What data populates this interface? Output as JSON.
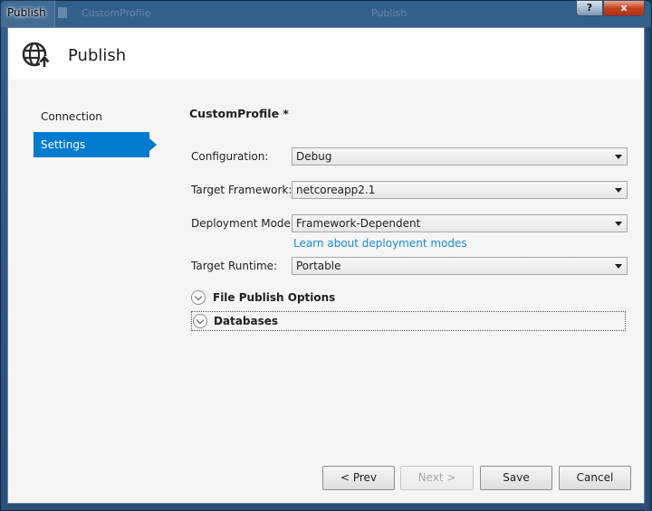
{
  "window": {
    "title": "Publish",
    "ghost_tab_1": "CustomProfile",
    "ghost_tab_2": "Publish",
    "help_label": "?",
    "close_label": "x"
  },
  "header": {
    "title": "Publish",
    "icon": "globe-publish-icon"
  },
  "nav": {
    "items": [
      {
        "label": "Connection",
        "active": false
      },
      {
        "label": "Settings",
        "active": true
      }
    ]
  },
  "profile": {
    "name": "CustomProfile *"
  },
  "form": {
    "configuration": {
      "label": "Configuration:",
      "value": "Debug"
    },
    "target_framework": {
      "label": "Target Framework:",
      "value": "netcoreapp2.1"
    },
    "deployment_mode": {
      "label": "Deployment Mode:",
      "value": "Framework-Dependent"
    },
    "deployment_link": "Learn about deployment modes",
    "target_runtime": {
      "label": "Target Runtime:",
      "value": "Portable"
    }
  },
  "sections": {
    "file_publish_options": "File Publish Options",
    "databases": "Databases"
  },
  "buttons": {
    "prev": "< Prev",
    "next": "Next >",
    "save": "Save",
    "cancel": "Cancel"
  },
  "colors": {
    "accent": "#007acc",
    "link": "#1a8ad4"
  }
}
